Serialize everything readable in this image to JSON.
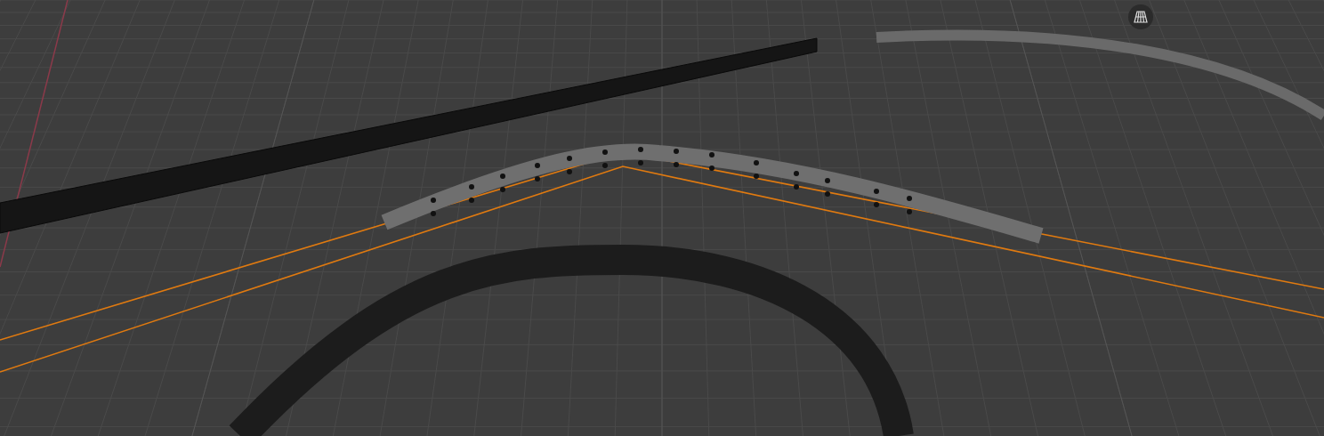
{
  "viewport": {
    "overlay_button": {
      "kind": "grid"
    }
  }
}
